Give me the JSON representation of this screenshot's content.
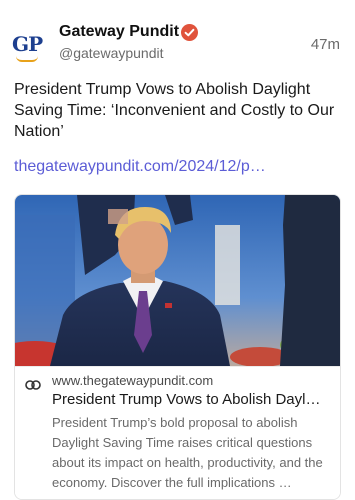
{
  "post": {
    "author": {
      "name": "Gateway Pundit",
      "handle": "@gatewaypundit",
      "avatar_text": "GP",
      "verified_icon": "verified-badge-icon",
      "verified_color": "#e0533c"
    },
    "time": "47m",
    "text": "President Trump Vows to Abolish Daylight Saving Time: ‘Inconvenient and Costly to Our Nation’",
    "link_text": "thegatewaypundit.com/2024/12/p…",
    "link_color": "#5c5dd6"
  },
  "card": {
    "link_icon": "link-icon",
    "domain": "www.thegatewaypundit.com",
    "title": "President Trump Vows to Abolish Dayl…",
    "description": "President Trump’s bold proposal to abolish Daylight Saving Time raises critical questions about its impact on health, productivity, and the economy. Discover the full implications …"
  }
}
